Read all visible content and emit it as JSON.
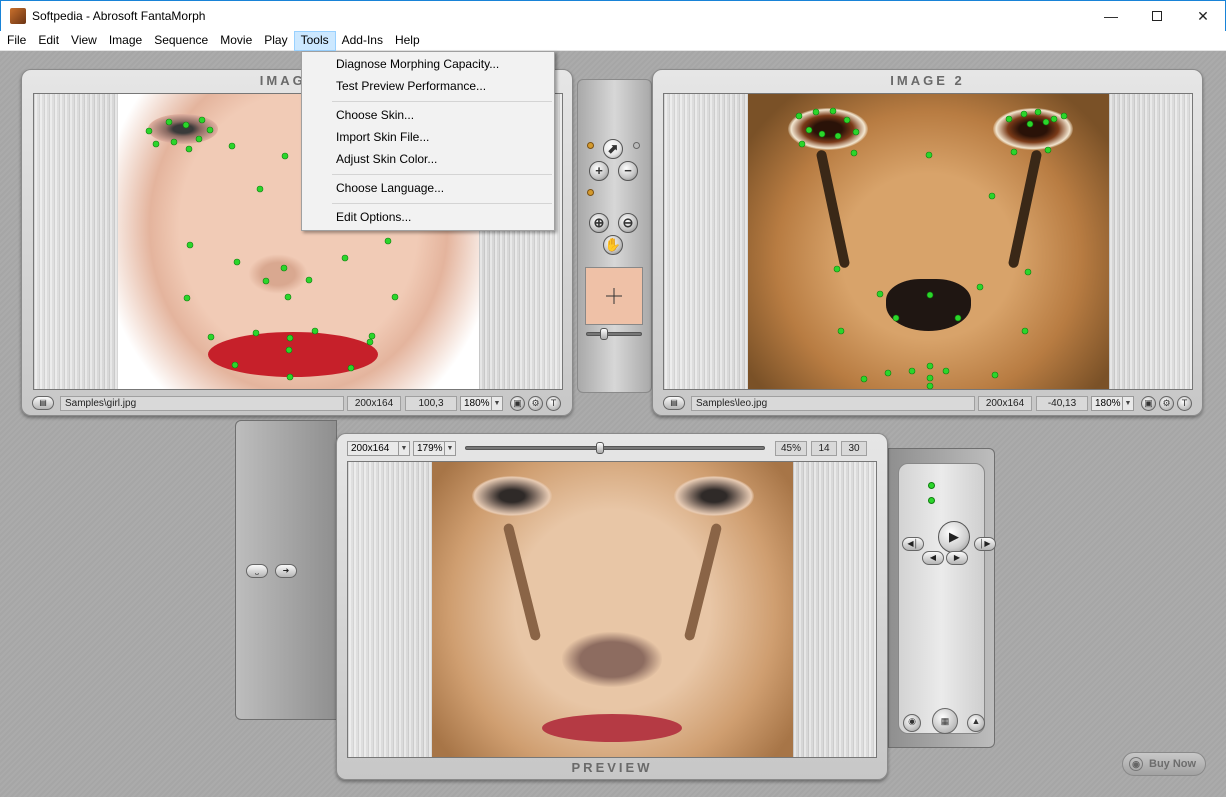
{
  "window": {
    "title": "Softpedia - Abrosoft FantaMorph"
  },
  "menubar": [
    "File",
    "Edit",
    "View",
    "Image",
    "Sequence",
    "Movie",
    "Play",
    "Tools",
    "Add-Ins",
    "Help"
  ],
  "tools_menu": {
    "items": [
      "Diagnose Morphing Capacity...",
      "Test Preview Performance...",
      "Choose Skin...",
      "Import Skin File...",
      "Adjust Skin Color...",
      "Choose Language...",
      "Edit Options..."
    ]
  },
  "image1": {
    "title": "IMAGE 1",
    "file": "Samples\\girl.jpg",
    "size": "200x164",
    "coord": "100,3",
    "zoom": "180%"
  },
  "image2": {
    "title": "IMAGE 2",
    "file": "Samples\\leo.jpg",
    "size": "200x164",
    "coord": "-40,13",
    "zoom": "180%"
  },
  "preview": {
    "title": "PREVIEW",
    "size": "200x164",
    "zoom": "179%",
    "percent": "45%",
    "frame": "14",
    "fps": "30",
    "position": 0.45
  },
  "buy_now": {
    "label": "Buy Now"
  },
  "icons": {
    "zoom_in": "+",
    "zoom_out": "−",
    "pan": "hand-icon",
    "play": "▶",
    "crosshair": "crosshair-icon"
  },
  "colors": {
    "dot_green": "#2bd62b",
    "menu_highlight": "#cce8ff",
    "skin_swatch": "#efc1a7"
  }
}
